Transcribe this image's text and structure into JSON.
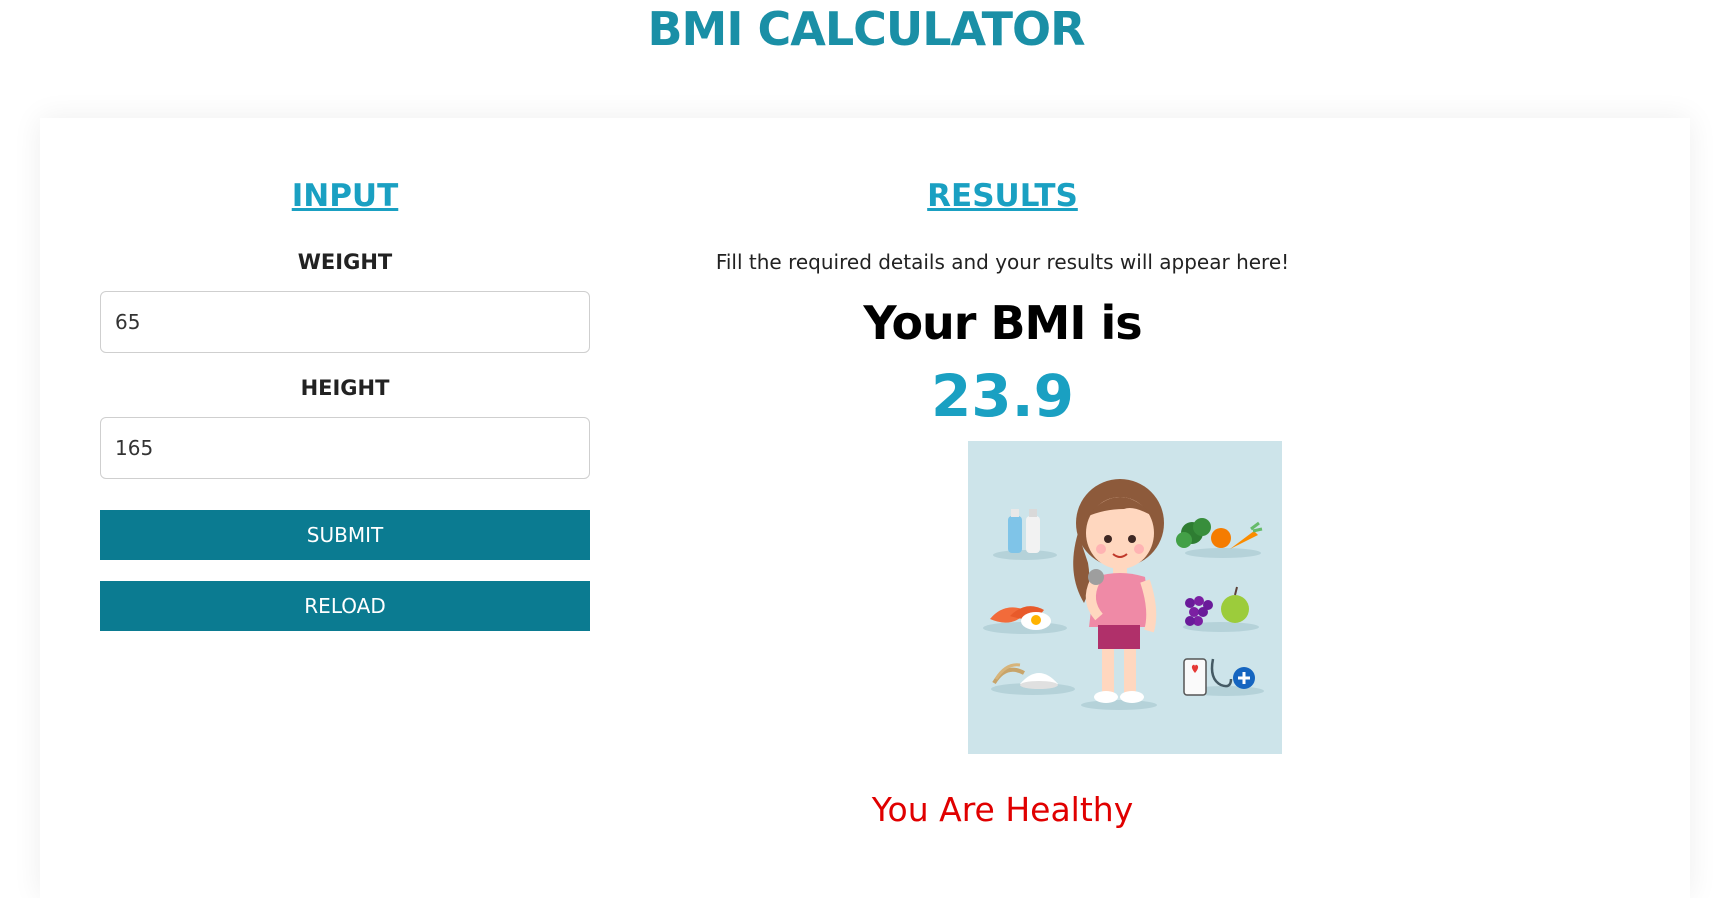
{
  "header": {
    "title": "BMI CALCULATOR"
  },
  "input_panel": {
    "heading": "INPUT",
    "weight_label": "WEIGHT",
    "weight_value": "65",
    "height_label": "HEIGHT",
    "height_value": "165",
    "submit_label": "SUBMIT",
    "reload_label": "RELOAD"
  },
  "results_panel": {
    "heading": "RESULTS",
    "hint": "Fill the required details and your results will appear here!",
    "bmi_label": "Your BMI is",
    "bmi_value": "23.9",
    "status": "You Are Healthy"
  },
  "colors": {
    "title": "#1a8fa6",
    "accent": "#1aa0c2",
    "button": "#0b7b91",
    "status": "#e00000",
    "illustration_bg": "#cde4ea"
  }
}
